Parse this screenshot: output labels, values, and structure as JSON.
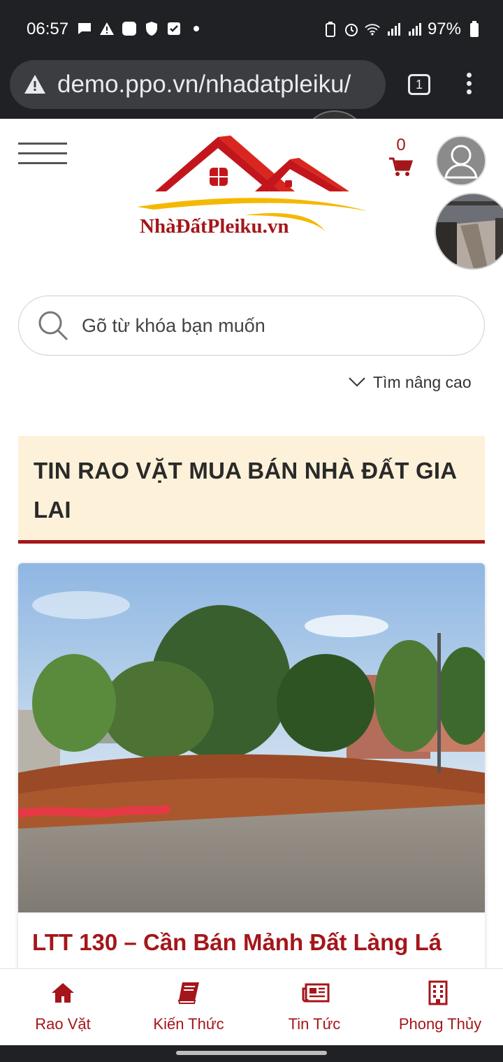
{
  "status_bar": {
    "time": "06:57",
    "battery": "97%"
  },
  "browser": {
    "url": "demo.ppo.vn/nhadatpleiku/",
    "tab_count": "1"
  },
  "header": {
    "cart_count": "0",
    "logo_text": "NhàĐấtPleiku.vn"
  },
  "search": {
    "placeholder": "Gõ từ khóa bạn muốn",
    "advanced_label": "Tìm nâng cao"
  },
  "section": {
    "title": "TIN RAO VẶT MUA BÁN NHÀ ĐẤT GIA LAI"
  },
  "listing": {
    "title": "LTT 130 – Cần Bán Mảnh Đất Làng Lá"
  },
  "bottom_nav": {
    "items": [
      {
        "label": "Rao Vặt",
        "icon": "home-icon"
      },
      {
        "label": "Kiến Thức",
        "icon": "book-icon"
      },
      {
        "label": "Tin Tức",
        "icon": "newspaper-icon"
      },
      {
        "label": "Phong Thủy",
        "icon": "building-icon"
      }
    ]
  },
  "colors": {
    "brand_red": "#a4161a",
    "section_bg": "#fdf2d9",
    "logo_yellow": "#f5b800"
  }
}
